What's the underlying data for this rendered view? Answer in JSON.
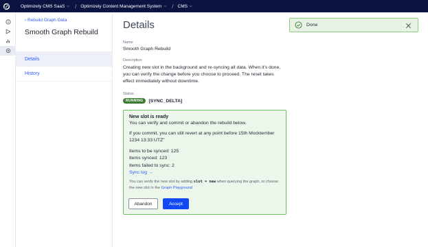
{
  "topbar": {
    "crumbs": [
      "Optimizely CMS SaaS",
      "Optimizely Content Management System",
      "CMS"
    ]
  },
  "sidenav": {
    "back_label": "Rebuild Graph Data",
    "title": "Smooth Graph Rebuild",
    "items": [
      {
        "label": "Details",
        "active": true
      },
      {
        "label": "History",
        "active": false
      }
    ]
  },
  "main": {
    "heading": "Details",
    "name_label": "Name",
    "name_value": "Smooth Graph Rebuild",
    "description_label": "Description",
    "description_value": "Creating new slot in the background and re-syncing all data. When it's done, you can verify the change before you choose to proceed. The reset takes effect immediately without downtime.",
    "status_label": "Status",
    "status_badge": "RUNNING",
    "status_text": "[SYNC_DELTA]"
  },
  "panel": {
    "title": "New slot is ready",
    "line1": "You can verify and commit or abandon the rebuild below.",
    "line2": "If you commit, you can still revert at any point before 15th Mocktember 1234 13:33 UTZ\"",
    "items_to_sync": "Items to be synced: 125",
    "items_synced": "Items synced: 123",
    "items_failed": "Items failed to sync: 2",
    "sync_log": "Sync log →",
    "hint_pre": "You can verify the new slot by adding",
    "hint_code": "slot = new",
    "hint_mid": "when querying the graph, or choose the new slot in the",
    "hint_link": "Graph Playground",
    "abandon_label": "Abandon",
    "accept_label": "Accept"
  },
  "toast": {
    "text": "Done"
  },
  "colors": {
    "topbar": "#0b1340",
    "accent": "#2e5bff",
    "success": "#3e7d33",
    "panel_bg": "#edf6ea"
  }
}
